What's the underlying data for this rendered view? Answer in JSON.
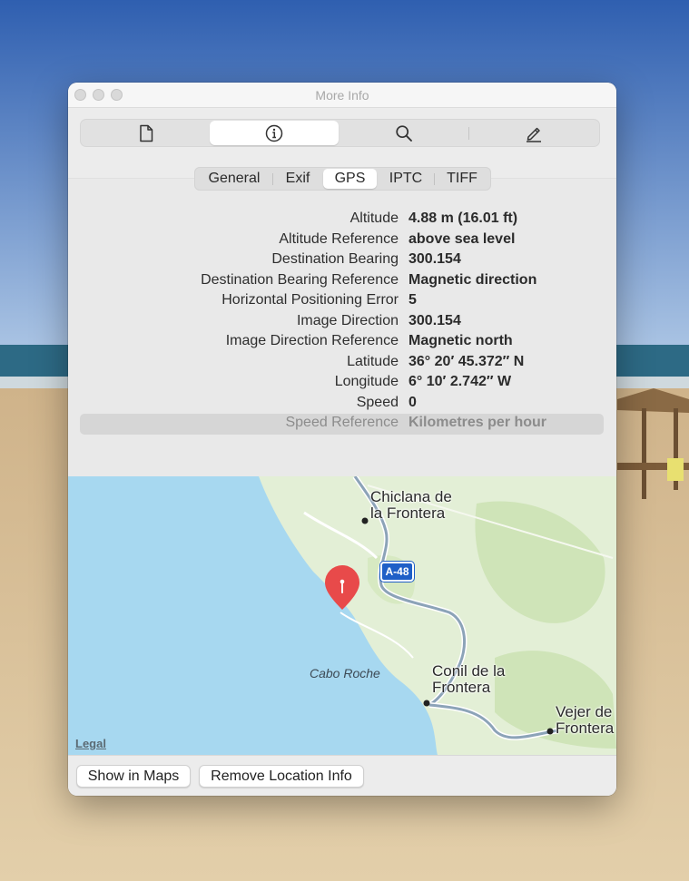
{
  "window": {
    "title": "More Info"
  },
  "toolbar": {
    "buttons": [
      {
        "icon": "document-icon",
        "selected": false
      },
      {
        "icon": "info-icon",
        "selected": true
      },
      {
        "icon": "search-icon",
        "selected": false
      },
      {
        "icon": "pencil-icon",
        "selected": false
      }
    ]
  },
  "tabs": [
    {
      "label": "General",
      "selected": false
    },
    {
      "label": "Exif",
      "selected": false
    },
    {
      "label": "GPS",
      "selected": true
    },
    {
      "label": "IPTC",
      "selected": false
    },
    {
      "label": "TIFF",
      "selected": false
    }
  ],
  "gps": [
    {
      "key": "Altitude",
      "value": "4.88 m (16.01 ft)"
    },
    {
      "key": "Altitude Reference",
      "value": "above sea level"
    },
    {
      "key": "Destination Bearing",
      "value": "300.154"
    },
    {
      "key": "Destination Bearing Reference",
      "value": "Magnetic direction"
    },
    {
      "key": "Horizontal Positioning Error",
      "value": "5"
    },
    {
      "key": "Image Direction",
      "value": "300.154"
    },
    {
      "key": "Image Direction Reference",
      "value": "Magnetic north"
    },
    {
      "key": "Latitude",
      "value": "36° 20′ 45.372″ N"
    },
    {
      "key": "Longitude",
      "value": "6° 10′ 2.742″ W"
    },
    {
      "key": "Speed",
      "value": "0"
    },
    {
      "key": "Speed Reference",
      "value": "Kilometres per hour",
      "selected": true
    }
  ],
  "map": {
    "places": [
      {
        "line1": "Chiclana de",
        "line2": "la Frontera"
      },
      {
        "line1": "Conil de la",
        "line2": "Frontera"
      },
      {
        "line1": "Vejer de",
        "line2": "Frontera"
      }
    ],
    "cape": "Cabo Roche",
    "road": "A-48",
    "legal": "Legal",
    "colors": {
      "sea": "#a7d8f0",
      "land": "#e3efd6",
      "road": "#8ca3b8",
      "pin": "#e84a4a"
    }
  },
  "footer": {
    "show_in_maps": "Show in Maps",
    "remove_location": "Remove Location Info"
  }
}
